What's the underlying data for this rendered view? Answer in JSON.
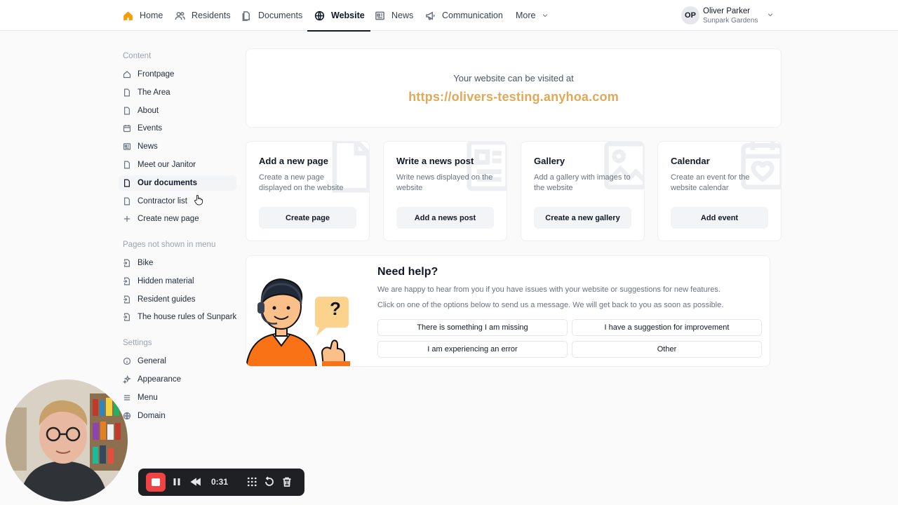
{
  "nav": {
    "home": "Home",
    "residents": "Residents",
    "documents": "Documents",
    "website": "Website",
    "news": "News",
    "communication": "Communication",
    "more": "More"
  },
  "user": {
    "initials": "OP",
    "name": "Oliver Parker",
    "org": "Sunpark Gardens"
  },
  "sidebar": {
    "content_heading": "Content",
    "content_items": [
      "Frontpage",
      "The Area",
      "About",
      "Events",
      "News",
      "Meet our Janitor",
      "Our documents",
      "Contractor list"
    ],
    "create_page": "Create new page",
    "hidden_heading": "Pages not shown in menu",
    "hidden_items": [
      "Bike",
      "Hidden material",
      "Resident guides",
      "The house rules of Sunpark"
    ],
    "settings_heading": "Settings",
    "settings_items": [
      "General",
      "Appearance",
      "Menu",
      "Domain"
    ]
  },
  "visit": {
    "label": "Your website can be visited at",
    "url": "https://olivers-testing.anyhoa.com"
  },
  "actions": [
    {
      "title": "Add a new page",
      "desc": "Create a new page displayed on the website",
      "button": "Create page"
    },
    {
      "title": "Write a news post",
      "desc": "Write news displayed on the website",
      "button": "Add a news post"
    },
    {
      "title": "Gallery",
      "desc": "Add a gallery with images to the website",
      "button": "Create a new gallery"
    },
    {
      "title": "Calendar",
      "desc": "Create an event for the website calendar",
      "button": "Add event"
    }
  ],
  "help": {
    "title": "Need help?",
    "line1": "We are happy to hear from you if you have issues with your website or suggestions for new features.",
    "line2": "Click on one of the options below to send us a message. We will get back to you as soon as possible.",
    "options": [
      "There is something I am missing",
      "I have a suggestion for improvement",
      "I am experiencing an error",
      "Other"
    ],
    "badge": "?"
  },
  "recorder": {
    "time": "0:31"
  },
  "colors": {
    "accent_url": "#e0a95a",
    "home_icon": "#f59e0b",
    "record": "#ef4444"
  }
}
